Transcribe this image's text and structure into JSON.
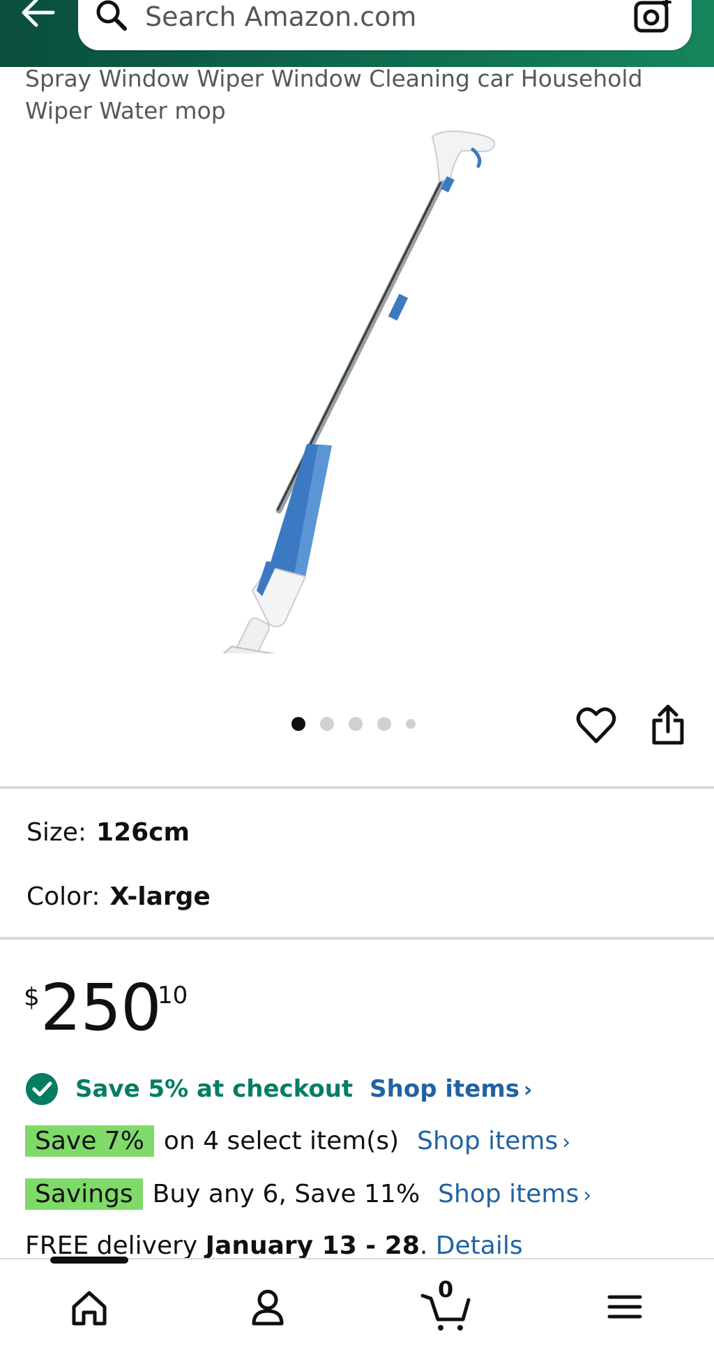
{
  "search": {
    "placeholder": "Search Amazon.com"
  },
  "product": {
    "title": "Spray Window Wiper Window Cleaning car Household Wiper Water mop",
    "image_icon": "spray-mop-image",
    "image_count": 5,
    "active_image": 1
  },
  "variations": {
    "size_label": "Size:",
    "size_value": "126cm",
    "color_label": "Color:",
    "color_value": "X-large"
  },
  "price": {
    "symbol": "$",
    "whole": "250",
    "fraction": "10"
  },
  "promotions": {
    "checkout_text": "Save 5% at checkout",
    "checkout_link": "Shop items",
    "select_badge": "Save 7%",
    "select_text": "on 4 select item(s)",
    "select_link": "Shop items",
    "savings_badge": "Savings",
    "savings_text": "Buy any 6, Save 11%",
    "savings_link": "Shop items",
    "chevron": "›"
  },
  "delivery": {
    "prefix": "FREE delivery",
    "dates": "January 13 - 28",
    "separator": ".",
    "details_link": "Details"
  },
  "bottom_nav": {
    "items": [
      "home-icon",
      "account-icon",
      "cart-icon",
      "menu-icon"
    ],
    "cart_count": "0"
  },
  "colors": {
    "header_green": "#0f6b4f",
    "link_blue": "#2162a1",
    "promo_green": "#067d62",
    "badge_green": "#7fda69",
    "mop_blue": "#3b79c3"
  }
}
